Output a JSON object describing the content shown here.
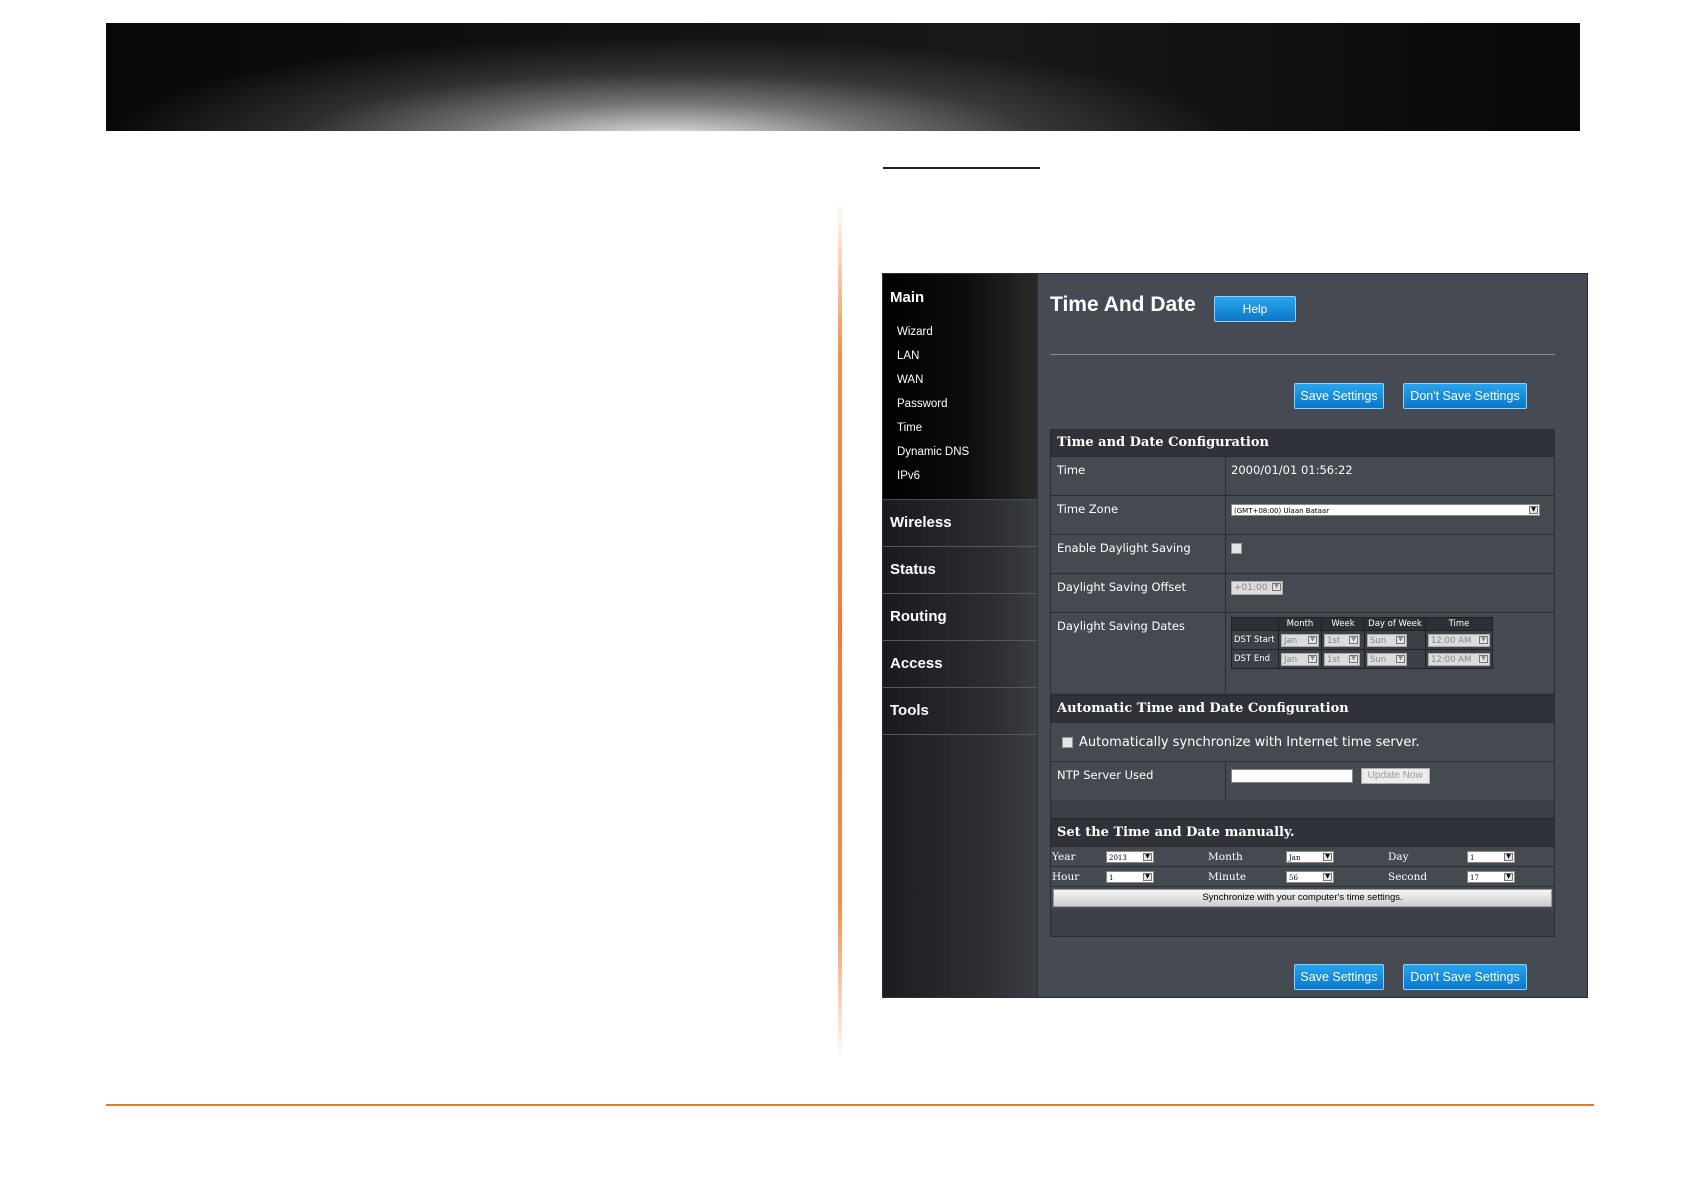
{
  "nav": {
    "main": "Main",
    "items": [
      "Wizard",
      "LAN",
      "WAN",
      "Password",
      "Time",
      "Dynamic DNS",
      "IPv6"
    ],
    "sections": [
      "Wireless",
      "Status",
      "Routing",
      "Access",
      "Tools"
    ]
  },
  "page": {
    "title": "Time And Date",
    "help": "Help",
    "save": "Save Settings",
    "dont_save": "Don't Save Settings"
  },
  "config": {
    "heading": "Time and Date Configuration",
    "time_label": "Time",
    "time_value": "2000/01/01 01:56:22",
    "zone_label": "Time Zone",
    "zone_value": "(GMT+08:00) Ulaan Bataar",
    "dst_enable_label": "Enable Daylight Saving",
    "dst_offset_label": "Daylight Saving Offset",
    "dst_offset_value": "+01:00",
    "dst_dates_label": "Daylight Saving Dates",
    "dst_headers": [
      "Month",
      "Week",
      "Day of Week",
      "Time"
    ],
    "dst_start": {
      "label": "DST Start",
      "month": "Jan",
      "week": "1st",
      "day": "Sun",
      "time": "12:00 AM"
    },
    "dst_end": {
      "label": "DST End",
      "month": "Jan",
      "week": "1st",
      "day": "Sun",
      "time": "12:00 AM"
    }
  },
  "auto": {
    "heading": "Automatic Time and Date Configuration",
    "sync_label": "Automatically synchronize with Internet time server.",
    "ntp_label": "NTP Server Used",
    "update": "Update Now"
  },
  "manual": {
    "heading": "Set the Time and Date manually.",
    "year_label": "Year",
    "year": "2013",
    "month_label": "Month",
    "month": "Jan",
    "day_label": "Day",
    "day": "1",
    "hour_label": "Hour",
    "hour": "1",
    "minute_label": "Minute",
    "minute": "56",
    "second_label": "Second",
    "second": "17",
    "sync_button": "Synchronize with your computer's time settings."
  },
  "colors": {
    "accent_blue": "#0b76c8",
    "rule_orange": "#e07a30"
  }
}
